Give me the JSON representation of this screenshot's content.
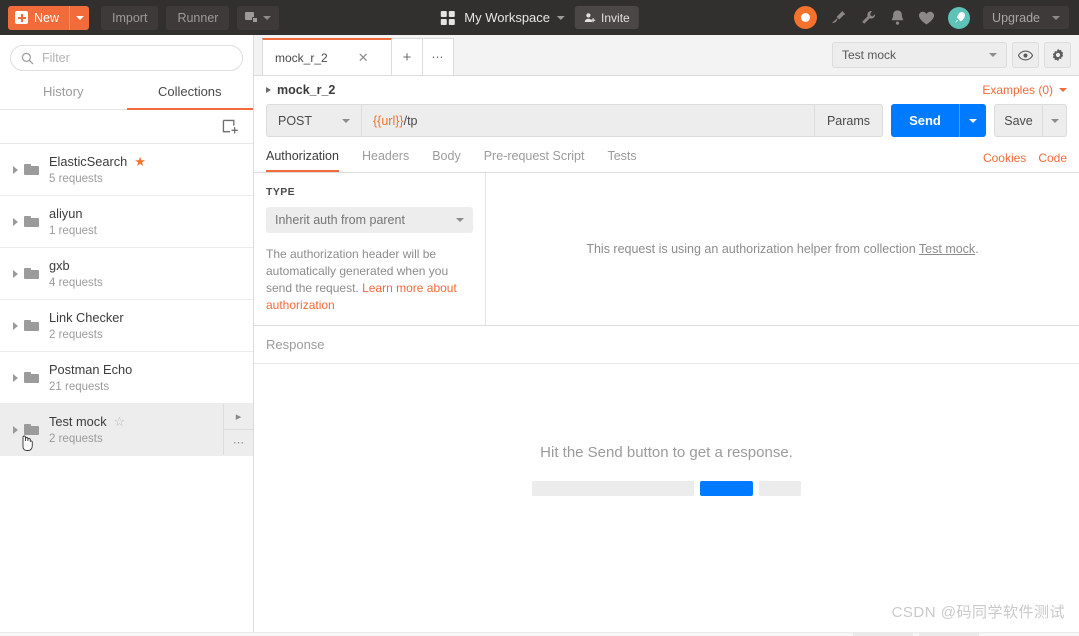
{
  "topbar": {
    "new_label": "New",
    "import_label": "Import",
    "runner_label": "Runner",
    "new_window_icon": "new-window-icon",
    "workspace_label": "My Workspace",
    "invite_label": "Invite",
    "upgrade_label": "Upgrade",
    "icons": [
      "postman-logo-icon",
      "satellite-icon",
      "wrench-icon",
      "bell-icon",
      "heart-icon",
      "rocket-icon"
    ]
  },
  "sidebar": {
    "filter_placeholder": "Filter",
    "tabs": [
      {
        "label": "History",
        "active": false
      },
      {
        "label": "Collections",
        "active": true
      }
    ],
    "new_collection_icon": "new-collection-icon",
    "collections": [
      {
        "name": "ElasticSearch",
        "count": "5 requests",
        "starred": true,
        "hovered": false
      },
      {
        "name": "aliyun",
        "count": "1 request",
        "starred": false,
        "hovered": false
      },
      {
        "name": "gxb",
        "count": "4 requests",
        "starred": false,
        "hovered": false
      },
      {
        "name": "Link Checker",
        "count": "2 requests",
        "starred": false,
        "hovered": false
      },
      {
        "name": "Postman Echo",
        "count": "21 requests",
        "starred": false,
        "hovered": false
      },
      {
        "name": "Test mock",
        "count": "2 requests",
        "starred": false,
        "hovered": true
      }
    ]
  },
  "main": {
    "request_tab": {
      "label": "mock_r_2",
      "close_icon": "close-icon"
    },
    "add_tab_icon": "plus-icon",
    "tab_options_icon": "ellipsis-icon",
    "environment": {
      "selected": "Test mock",
      "eye_icon": "eye-icon",
      "settings_icon": "gear-icon"
    },
    "breadcrumb": "mock_r_2",
    "examples_label": "Examples (0)",
    "request": {
      "method": "POST",
      "url_variable": "{{url}}",
      "url_path": "/tp",
      "params_label": "Params",
      "send_label": "Send",
      "save_label": "Save"
    },
    "request_tabs": [
      {
        "label": "Authorization",
        "active": true
      },
      {
        "label": "Headers",
        "active": false
      },
      {
        "label": "Body",
        "active": false
      },
      {
        "label": "Pre-request Script",
        "active": false
      },
      {
        "label": "Tests",
        "active": false
      }
    ],
    "right_links": [
      "Cookies",
      "Code"
    ],
    "authorization": {
      "type_label": "TYPE",
      "type_value": "Inherit auth from parent",
      "description_text": "The authorization header will be automatically generated when you send the request. ",
      "description_link": "Learn more about authorization",
      "helper_prefix": "This request is using an authorization helper from collection ",
      "helper_collection": "Test mock",
      "helper_suffix": "."
    },
    "response": {
      "title": "Response",
      "hint": "Hit the Send button to get a response."
    }
  },
  "watermark": "CSDN @码同学软件测试",
  "colors": {
    "brand_orange": "#f26b3a",
    "send_blue": "#007bff",
    "topbar_dark": "#32302f",
    "rocket_teal": "#5ec2b6"
  }
}
